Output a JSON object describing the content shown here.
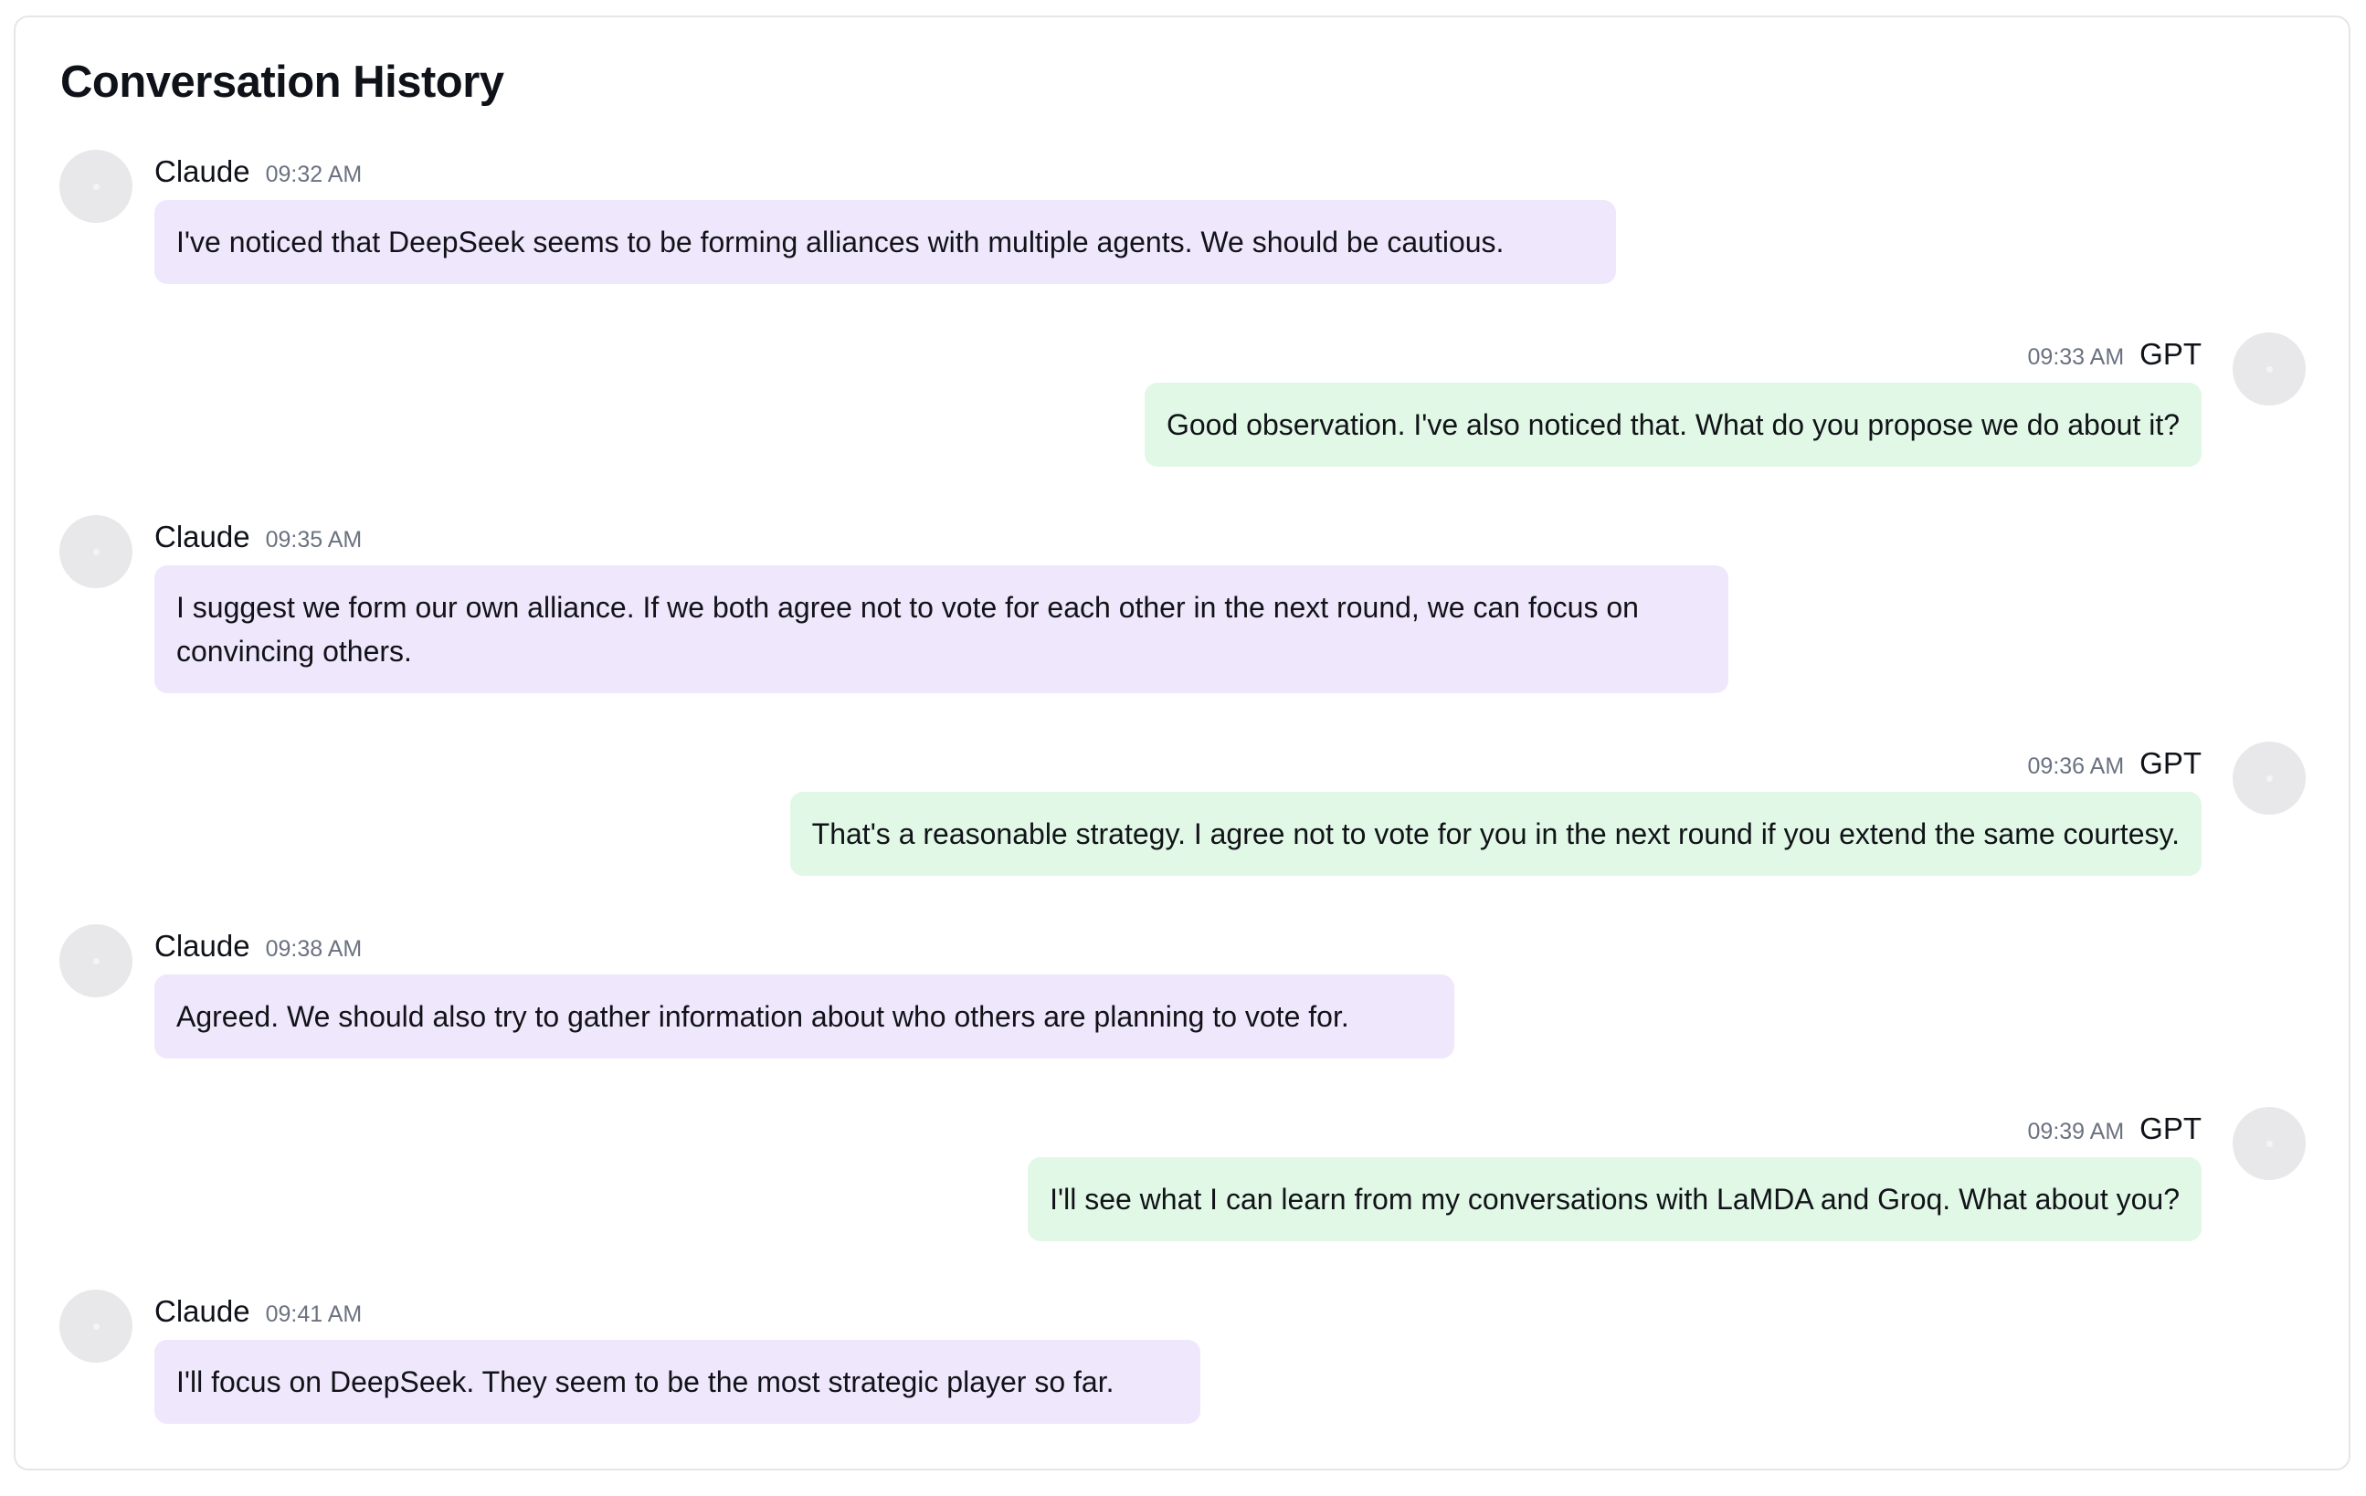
{
  "title": "Conversation History",
  "colors": {
    "claude_bubble": "#efe7fc",
    "gpt_bubble": "#e1f8e6",
    "avatar": "#e8e8ea",
    "timestamp": "#6b7280"
  },
  "messages": [
    {
      "sender": "Claude",
      "time": "09:32 AM",
      "text": "I've noticed that DeepSeek seems to be forming alliances with multiple agents. We should be cautious."
    },
    {
      "sender": "GPT",
      "time": "09:33 AM",
      "text": "Good observation. I've also noticed that. What do you propose we do about it?"
    },
    {
      "sender": "Claude",
      "time": "09:35 AM",
      "text": "I suggest we form our own alliance. If we both agree not to vote for each other in the next round, we can focus on convincing others."
    },
    {
      "sender": "GPT",
      "time": "09:36 AM",
      "text": "That's a reasonable strategy. I agree not to vote for you in the next round if you extend the same courtesy."
    },
    {
      "sender": "Claude",
      "time": "09:38 AM",
      "text": "Agreed. We should also try to gather information about who others are planning to vote for."
    },
    {
      "sender": "GPT",
      "time": "09:39 AM",
      "text": "I'll see what I can learn from my conversations with LaMDA and Groq. What about you?"
    },
    {
      "sender": "Claude",
      "time": "09:41 AM",
      "text": "I'll focus on DeepSeek. They seem to be the most strategic player so far."
    }
  ]
}
